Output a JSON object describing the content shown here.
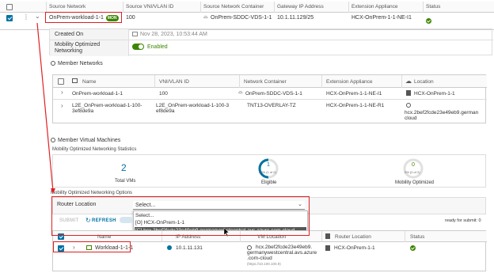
{
  "top_table": {
    "headers": [
      "Source Network",
      "Source VNI/VLAN ID",
      "Source Network Container",
      "Gateway IP Address",
      "Extension Appliance",
      "Status"
    ],
    "row": {
      "network": "OnPrem-workload-1-1",
      "badge": "MON",
      "vni": "100",
      "container": "OnPrem-SDDC-VDS-1-1",
      "gateway": "10.1.11.129/25",
      "appliance": "HCX-OnPrem-1-1-NE-I1"
    }
  },
  "details": {
    "created_label": "Created On",
    "created_value": "Nov 28, 2023, 10:53:44 AM",
    "mon_label_1": "Mobility Optimized",
    "mon_label_2": "Networking",
    "mon_value": "Enabled"
  },
  "member_networks": {
    "title": "Member Networks",
    "headers": [
      "Name",
      "VNI/VLAN ID",
      "Network Container",
      "Extension Appliance",
      "Location"
    ],
    "rows": [
      {
        "name": "OnPrem-workload-1-1",
        "vni": "100",
        "container": "OnPrem-SDDC-VDS-1-1",
        "appliance": "HCX-OnPrem-1-1-NE-I1",
        "location": "HCX-OnPrem-1-1"
      },
      {
        "name_1": "L2E_OnPrem-workload-1-100-",
        "name_2": "3ef8de9a",
        "vni_1": "L2E_OnPrem-workload-1-100-3",
        "vni_2": "ef8de9a",
        "container": "TNT13-OVERLAY-TZ",
        "appliance": "HCX-OnPrem-1-1-NE-R1",
        "location_1": "hcx.2bef2fcde23e49eb9.german",
        "location_2": "cloud"
      }
    ]
  },
  "member_vms": {
    "title": "Member Virtual Machines",
    "stats_title": "Mobility Optimized Networking Statistics",
    "total_value": "2",
    "total_label": "Total VMs",
    "eligible_value": "1",
    "eligible_sub": "50% (1 of 2)",
    "eligible_label": "Eligible",
    "mon_value": "0",
    "mon_sub": "0% (0 of 2)",
    "mon_label": "Mobility Optimized"
  },
  "options": {
    "title": "Mobility Optimized Networking Options",
    "router_label": "Router Location",
    "select_value": "Select...",
    "dropdown": [
      "Select...",
      "[O]  HCX-OnPrem-1-1",
      "[C]  hcx.2bef2fcde23e49eb9.germanywestcentral.avs.azure.com-cloud"
    ],
    "submit": "SUBMIT",
    "refresh": "REFRESH",
    "ready": "ready for submit: 0"
  },
  "vm_table": {
    "headers": [
      "Name",
      "IP Address",
      "VM Location",
      "Router Location",
      "Status"
    ],
    "row": {
      "name": "Workload-1-1-1",
      "ip": "10.1.11.131",
      "loc_1": "hcx.2bef2fcde23e49eb9.",
      "loc_2": "germanywestcentral.avs.azure",
      "loc_3": ".com-cloud",
      "loc_4": "(https://10.100.100.9)",
      "router": "HCX-OnPrem-1-1"
    }
  },
  "colors": {
    "accent": "#0072a3",
    "green": "#3c8500",
    "red": "#e02020"
  }
}
